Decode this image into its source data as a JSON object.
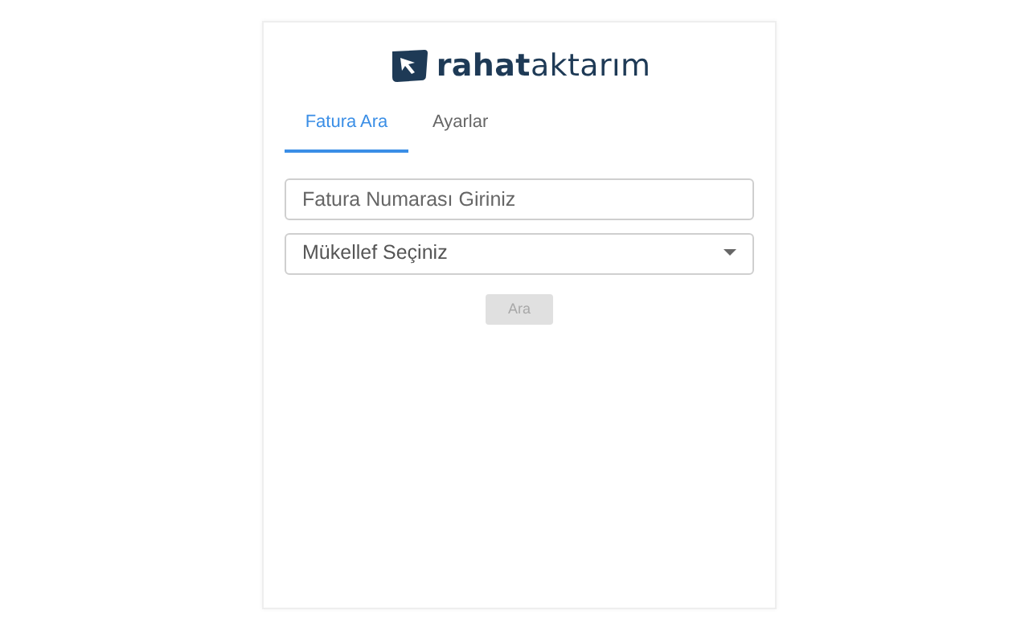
{
  "logo": {
    "text": "**rahat**aktarım"
  },
  "tabs": [
    {
      "label": "Fatura Ara",
      "selected": true
    },
    {
      "label": "Ayarlar",
      "selected": false
    }
  ],
  "invoice_field": {
    "placeholder": "Fatura Numarası Giriniz"
  },
  "taxpayer_select": {
    "placeholder": "Mükellef Seçiniz"
  },
  "search_button": {
    "label": "Ara",
    "disabled": true
  }
}
